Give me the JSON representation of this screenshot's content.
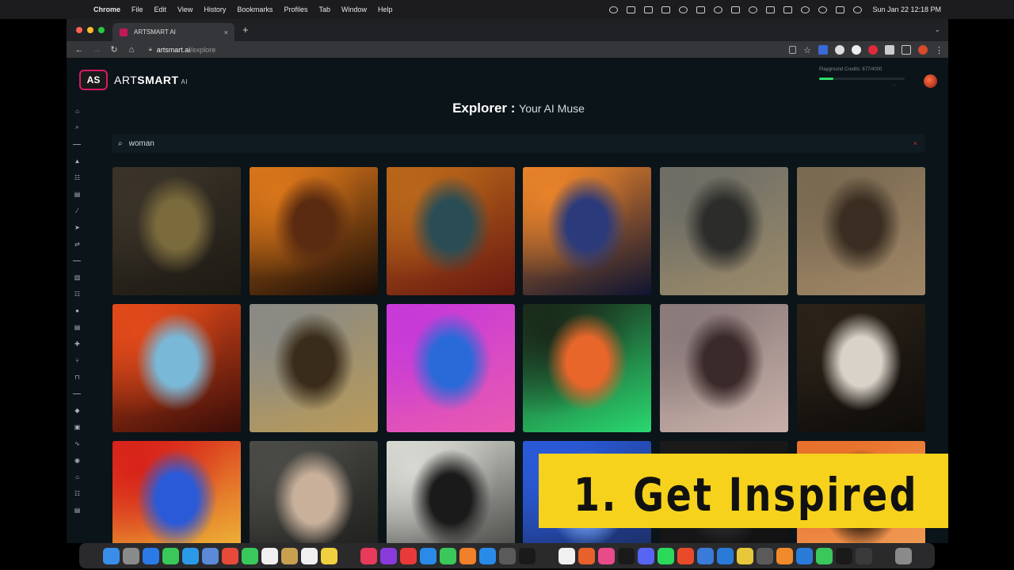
{
  "menubar": {
    "app": "Chrome",
    "items": [
      "File",
      "Edit",
      "View",
      "History",
      "Bookmarks",
      "Profiles",
      "Tab",
      "Window",
      "Help"
    ],
    "clock": "Sun Jan 22  12:18 PM"
  },
  "browser": {
    "tab_title": "ARTSMART AI",
    "url_host": "artsmart.ai",
    "url_path": "/explore"
  },
  "app": {
    "logo_mark": "AS",
    "brand_light": "ART",
    "brand_bold": "SMART",
    "brand_suffix": "AI",
    "credits_label": "Playground Credits: 677/4000",
    "credits_used_fraction": 0.17,
    "credits_more": "...",
    "title_bold": "Explorer :",
    "title_rest": "Your AI Muse",
    "search_value": "woman",
    "clear_icon": "×"
  },
  "gallery": [
    {
      "subject": "dark-queen-portrait",
      "colors": [
        "#3a3328",
        "#7a6a3c",
        "#1d1a14"
      ]
    },
    {
      "subject": "old-woman-beanie",
      "colors": [
        "#d8751a",
        "#5a2b10",
        "#1a0d06"
      ]
    },
    {
      "subject": "ornate-goddess",
      "colors": [
        "#b8661a",
        "#2a4d55",
        "#6b1a10"
      ]
    },
    {
      "subject": "steampunk-captain",
      "colors": [
        "#e8822a",
        "#2b3a7a",
        "#0e1430"
      ]
    },
    {
      "subject": "silver-mask-woman",
      "colors": [
        "#6e6e66",
        "#2c2c2a",
        "#9a8a6a"
      ]
    },
    {
      "subject": "bronze-warrior-woman",
      "colors": [
        "#7a6a52",
        "#3a2e22",
        "#a08666"
      ]
    },
    {
      "subject": "red-dragon",
      "colors": [
        "#e24a1a",
        "#7ab8d8",
        "#3a0d08"
      ]
    },
    {
      "subject": "golden-domes",
      "colors": [
        "#8a8a84",
        "#3a2c1a",
        "#b89a5a"
      ]
    },
    {
      "subject": "neon-dog-sunglasses",
      "colors": [
        "#c83ad8",
        "#2a6ad8",
        "#e85ab0"
      ]
    },
    {
      "subject": "neon-dog",
      "colors": [
        "#1a2a1a",
        "#e8662a",
        "#2ad870"
      ]
    },
    {
      "subject": "asian-woman-feathers",
      "colors": [
        "#8a7a7a",
        "#3a2a2a",
        "#c8b0a8"
      ]
    },
    {
      "subject": "white-sheep",
      "colors": [
        "#2a2218",
        "#d8d2c8",
        "#0e0c0a"
      ]
    },
    {
      "subject": "superman",
      "colors": [
        "#d8221a",
        "#2a5ad8",
        "#f0c83a"
      ]
    },
    {
      "subject": "crowned-woman",
      "colors": [
        "#4a4a46",
        "#c8b09a",
        "#1a1a18"
      ]
    },
    {
      "subject": "armored-dog",
      "colors": [
        "#d8d8d2",
        "#1a1a1a",
        "#3a3a38"
      ]
    },
    {
      "subject": "blue-sky-scene",
      "colors": [
        "#2a5ad8",
        "#6a9ae8",
        "#1a2a5a"
      ]
    },
    {
      "subject": "dark-scene",
      "colors": [
        "#1a1a1a",
        "#2a2a2a",
        "#111111"
      ]
    },
    {
      "subject": "orange-glow-scene",
      "colors": [
        "#e8702a",
        "#2a1a10",
        "#f0a05a"
      ]
    }
  ],
  "overlay": {
    "banner_text": "1.  Get Inspired",
    "banner_color": "#f6d21c"
  },
  "sidebar_icons": [
    "home-icon",
    "search-icon",
    "divider",
    "shapes-icon",
    "users-icon",
    "document-icon",
    "magic-wand-icon",
    "rocket-icon",
    "swap-icon",
    "divider",
    "file-icon",
    "group-icon",
    "person-icon",
    "list-icon",
    "puzzle-icon",
    "branch-icon",
    "bridge-icon",
    "divider",
    "tag-icon",
    "archive-icon",
    "pulse-icon",
    "help-icon",
    "inbox-icon",
    "team-icon",
    "table-icon"
  ],
  "dock_colors": [
    "#3a8de8",
    "#8a8a8a",
    "#2a7ae8",
    "#3ac85a",
    "#2a9ae8",
    "#5a8ad8",
    "#e84a3a",
    "#3ac85a",
    "#f0f0f0",
    "#c8a050",
    "#f0f0f0",
    "#f0d040",
    "#2a2a2a",
    "#e83a5a",
    "#8a3ad8",
    "#e83a3a",
    "#2a8ae8",
    "#3ac85a",
    "#f0802a",
    "#2a8ae8",
    "#5a5a5a",
    "#1a1a1a",
    "#2a2a2a",
    "#f0f0f0",
    "#e8602a",
    "#e84a8a",
    "#1a1a1a",
    "#5865f2",
    "#2ad85a",
    "#e84a2a",
    "#3a7ad8",
    "#2a7ad8",
    "#e8c83a",
    "#5a5a5a",
    "#f08a2a",
    "#2a7ad8",
    "#3ac85a",
    "#1a1a1a",
    "#3a3a3a",
    "#2a2a2a",
    "#8a8a8a"
  ]
}
